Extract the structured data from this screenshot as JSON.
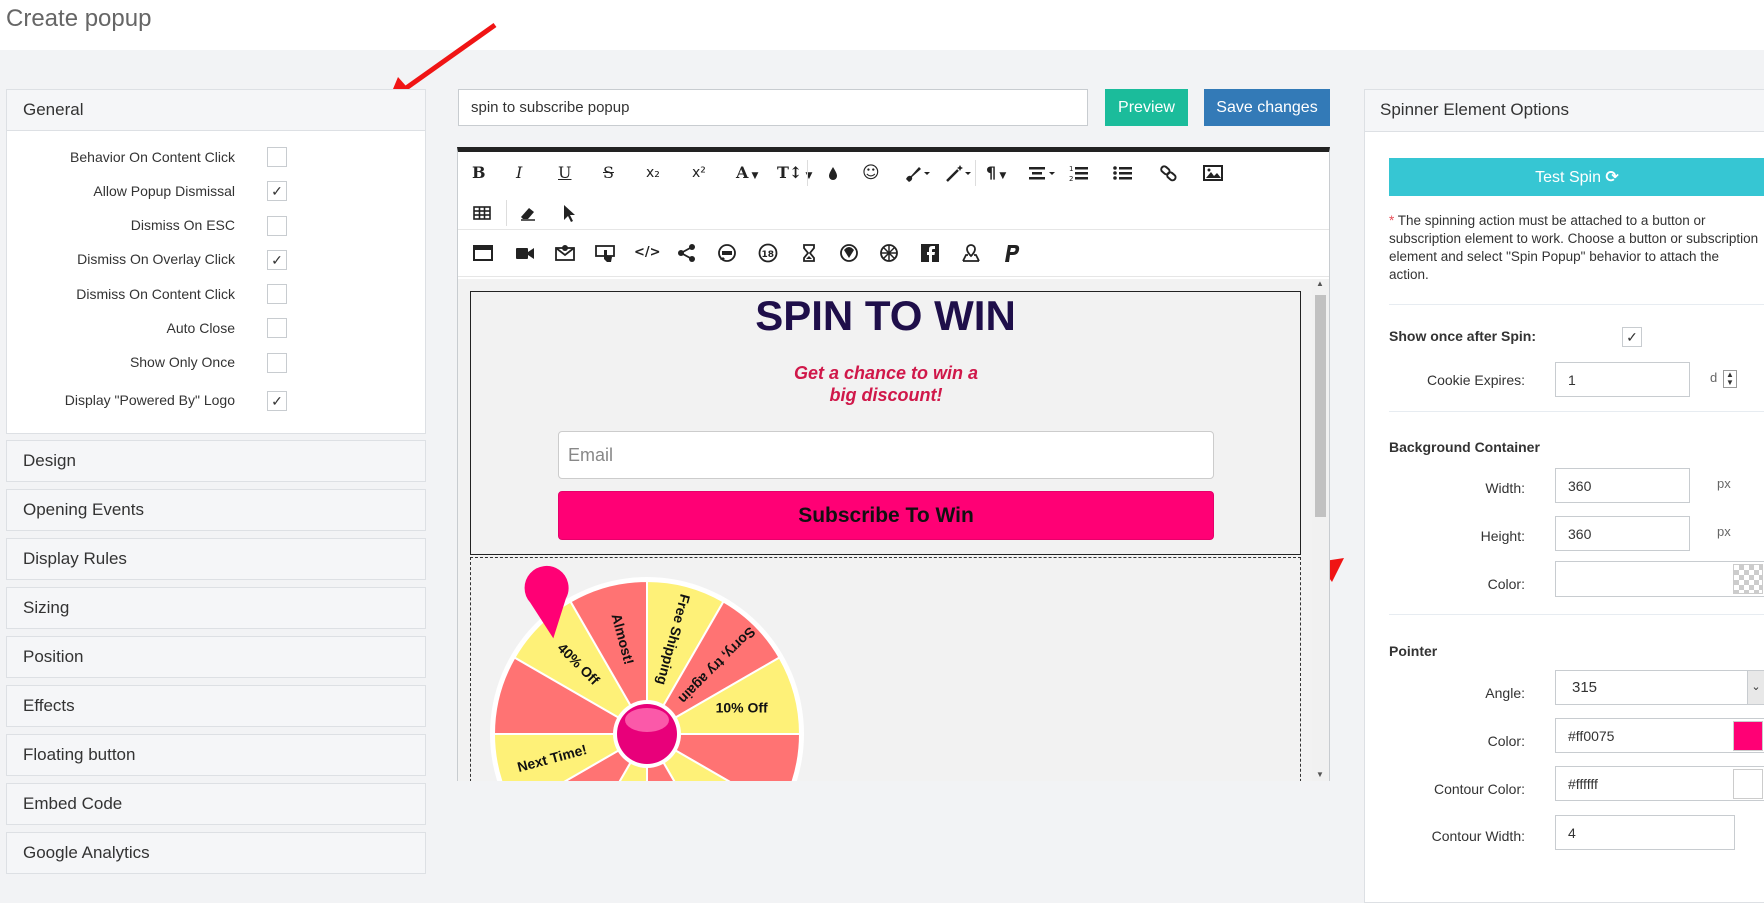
{
  "page": {
    "title": "Create popup"
  },
  "left": {
    "general_label": "General",
    "options": [
      {
        "label": "Behavior On Content Click",
        "checked": false
      },
      {
        "label": "Allow Popup Dismissal",
        "checked": true
      },
      {
        "label": "Dismiss On ESC",
        "checked": false
      },
      {
        "label": "Dismiss On Overlay Click",
        "checked": true
      },
      {
        "label": "Dismiss On Content Click",
        "checked": false
      },
      {
        "label": "Auto Close",
        "checked": false
      },
      {
        "label": "Show Only Once",
        "checked": false
      },
      {
        "label": "Display \"Powered By\" Logo",
        "checked": true
      }
    ],
    "sections": [
      "Design",
      "Opening Events",
      "Display Rules",
      "Sizing",
      "Position",
      "Effects",
      "Floating button",
      "Embed Code",
      "Google Analytics"
    ]
  },
  "center": {
    "popup_name": "spin to subscribe popup",
    "preview_label": "Preview",
    "save_label": "Save changes"
  },
  "toolbar": {
    "bold": "B",
    "italic": "I",
    "underline": "U",
    "strike": "S",
    "subscript": "x₂",
    "superscript": "x²",
    "font": "A",
    "size": "T↕"
  },
  "popup": {
    "title": "SPIN TO WIN",
    "subtitle": "Get a chance to win a big discount!",
    "email_placeholder": "Email",
    "button_label": "Subscribe To Win",
    "wheel": {
      "segments": [
        "40% Off",
        "Almost!",
        "Free Shipping",
        "Sorry, try again",
        "10% Off",
        "Next Time!"
      ],
      "colors": {
        "pink": "#ff7373",
        "yellow": "#fef178",
        "pointer": "#ff0075"
      }
    }
  },
  "right": {
    "title": "Spinner Element Options",
    "test_spin_label": "Test Spin",
    "note_star": "*",
    "note": "The spinning action must be attached to a button or subscription element to work. Choose a button or subscription element and select \"Spin Popup\" behavior to attach the action.",
    "show_once_label": "Show once after Spin:",
    "show_once_checked": true,
    "cookie_label": "Cookie Expires:",
    "cookie_value": "1",
    "cookie_unit": "d",
    "bg_title": "Background Container",
    "width_label": "Width:",
    "width_value": "360",
    "height_label": "Height:",
    "height_value": "360",
    "px_unit": "px",
    "color_label": "Color:",
    "pointer_title": "Pointer",
    "angle_label": "Angle:",
    "angle_value": "315",
    "pointer_color_label": "Color:",
    "pointer_color_value": "#ff0075",
    "contour_color_label": "Contour Color:",
    "contour_color_value": "#ffffff",
    "contour_width_label": "Contour Width:",
    "contour_width_value": "4"
  }
}
